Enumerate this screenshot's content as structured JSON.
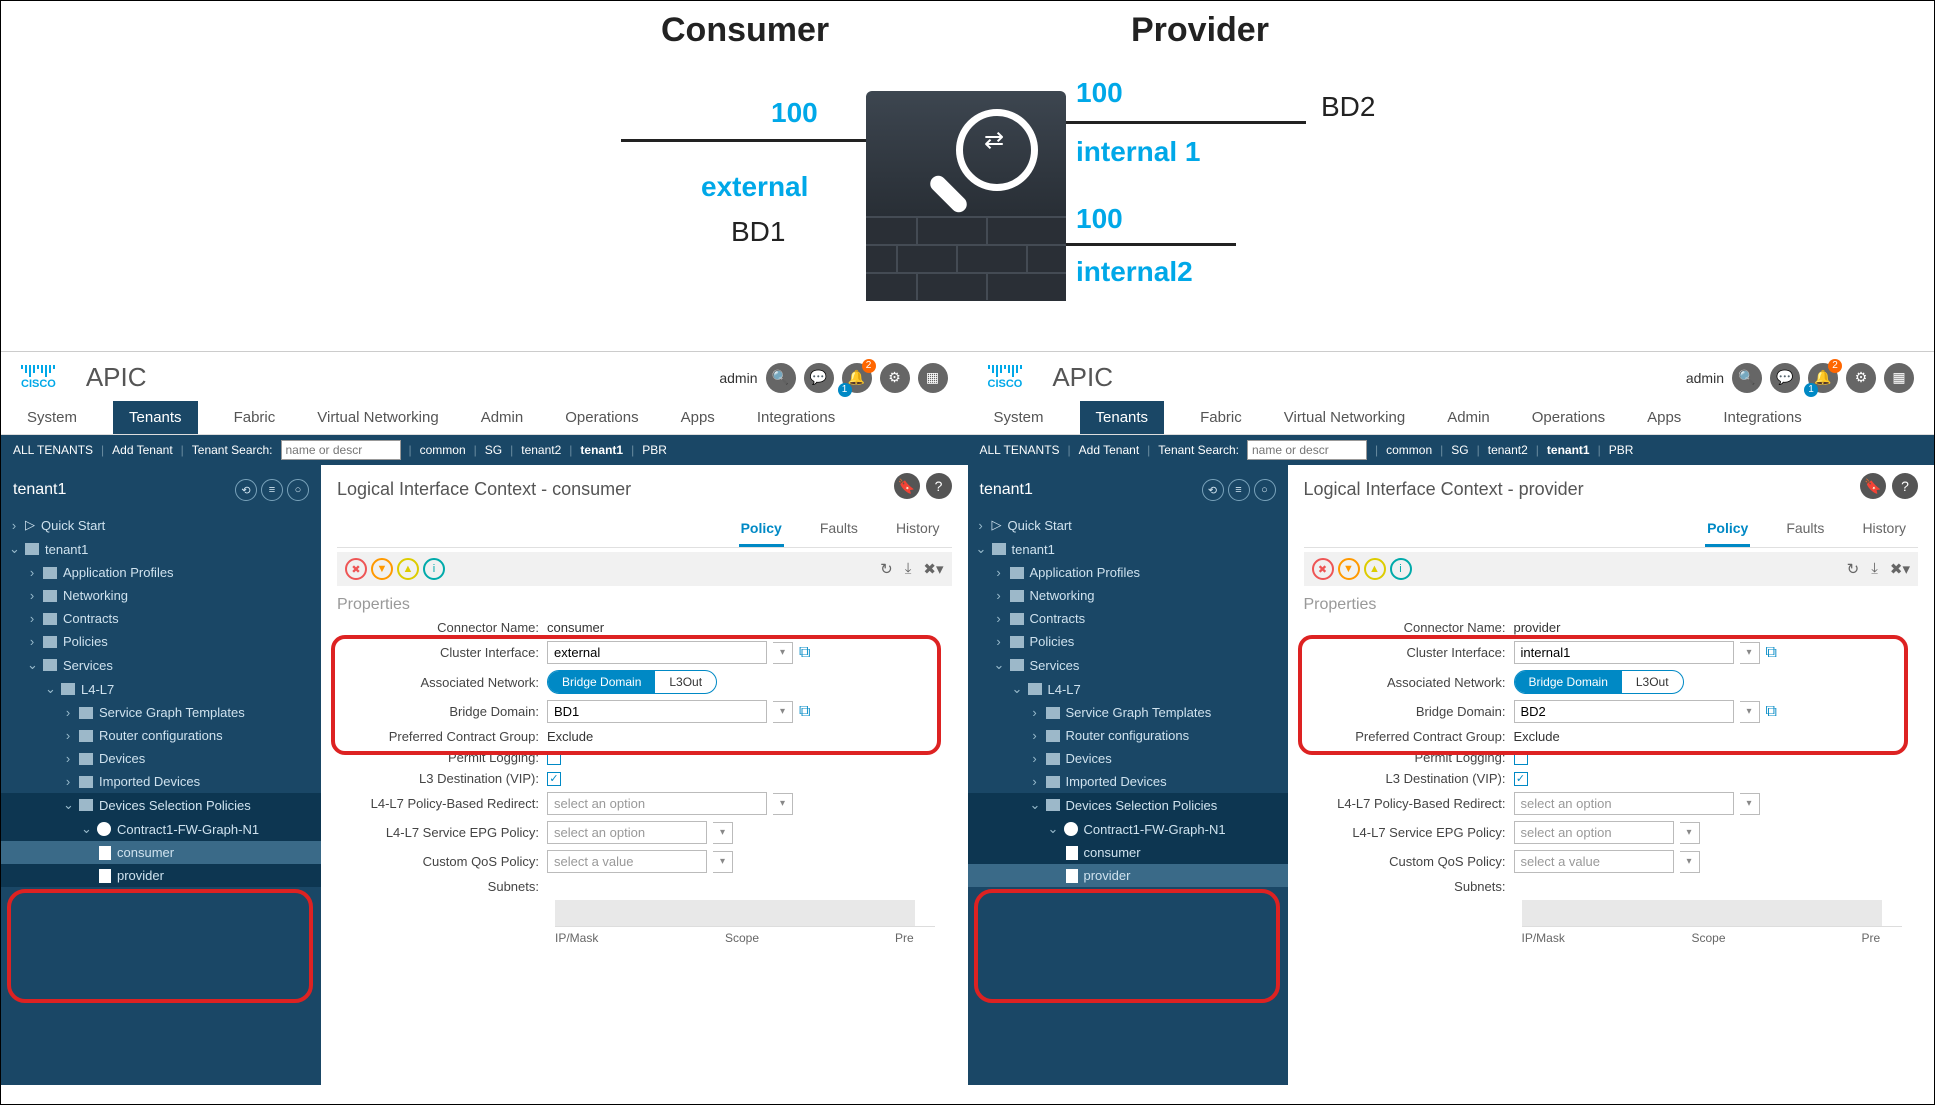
{
  "diagram": {
    "consumer_title": "Consumer",
    "provider_title": "Provider",
    "left_num": "100",
    "external": "external",
    "bd1": "BD1",
    "right_top_num": "100",
    "internal1": "internal 1",
    "bd2": "BD2",
    "right_bot_num": "100",
    "internal2": "internal2"
  },
  "apic": {
    "logo_text": "CISCO",
    "title": "APIC",
    "admin": "admin",
    "bell_badge": "2",
    "bell_badge2": "1",
    "top_tabs": [
      "System",
      "Tenants",
      "Fabric",
      "Virtual Networking",
      "Admin",
      "Operations",
      "Apps",
      "Integrations"
    ],
    "subbar": {
      "all_tenants": "ALL TENANTS",
      "add_tenant": "Add Tenant",
      "tenant_search": "Tenant Search:",
      "placeholder": "name or descr",
      "links": [
        "common",
        "SG",
        "tenant2",
        "tenant1",
        "PBR"
      ]
    },
    "tree": {
      "tenant": "tenant1",
      "quick_start": "Quick Start",
      "tenant_root": "tenant1",
      "items": [
        "Application Profiles",
        "Networking",
        "Contracts",
        "Policies",
        "Services"
      ],
      "l4l7": "L4-L7",
      "l4l7_items": [
        "Service Graph Templates",
        "Router configurations",
        "Devices",
        "Imported Devices",
        "Devices Selection Policies"
      ],
      "contract": "Contract1-FW-Graph-N1",
      "consumer": "consumer",
      "provider": "provider"
    },
    "detail_tabs": [
      "Policy",
      "Faults",
      "History"
    ],
    "props_title": "Properties",
    "labels": {
      "connector_name": "Connector Name:",
      "cluster_iface": "Cluster Interface:",
      "assoc_net": "Associated Network:",
      "bridge_domain": "Bridge Domain:",
      "pref_contract": "Preferred Contract Group:",
      "permit_logging": "Permit Logging:",
      "l3_dest": "L3 Destination (VIP):",
      "pbr": "L4-L7 Policy-Based Redirect:",
      "epg_policy": "L4-L7 Service EPG Policy:",
      "qos": "Custom QoS Policy:",
      "subnets": "Subnets:",
      "ipmask": "IP/Mask",
      "scope": "Scope",
      "pre": "Pre"
    },
    "toggle": {
      "bd": "Bridge Domain",
      "l3out": "L3Out"
    },
    "select_option": "select an option",
    "select_value": "select a value",
    "exclude": "Exclude"
  },
  "left_panel": {
    "title": "Logical Interface Context - consumer",
    "connector_name": "consumer",
    "cluster_iface": "external",
    "bridge_domain": "BD1",
    "tree_selected": "consumer"
  },
  "right_panel": {
    "title": "Logical Interface Context - provider",
    "connector_name": "provider",
    "cluster_iface": "internal1",
    "bridge_domain": "BD2",
    "tree_selected": "provider"
  }
}
